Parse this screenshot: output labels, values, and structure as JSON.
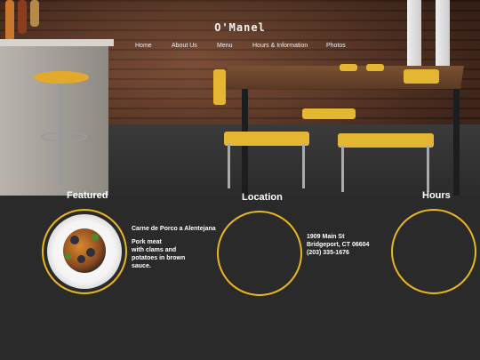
{
  "brand": "O'Manel",
  "nav": [
    "Home",
    "About Us",
    "Menu",
    "Hours & Information",
    "Photos"
  ],
  "featured": {
    "title": "Featured",
    "dish_name": "Carne de Porco a Alentejana",
    "desc_lines": [
      "Pork meat",
      "with clams and",
      "potatoes in brown",
      "sauce."
    ]
  },
  "location": {
    "title": "Location",
    "address_lines": [
      "1909 Main St",
      "Bridgeport, CT 06604",
      "(203) 335-1676"
    ]
  },
  "hours": {
    "title": "Hours"
  },
  "colors": {
    "accent": "#e8b722",
    "background": "#2a2a2a",
    "text": "#ffffff"
  }
}
